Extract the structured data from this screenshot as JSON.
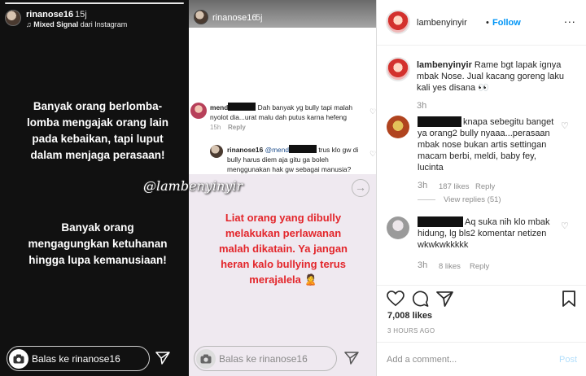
{
  "story_left": {
    "username": "rinanose16",
    "time": "15j",
    "music": "♫ Mixed Signal",
    "source": "dari Instagram",
    "paragraph1": "Banyak orang berlomba-lomba mengajak orang lain pada kebaikan, tapi luput dalam menjaga perasaan!",
    "paragraph2": "Banyak orang mengagungkan ketuhanan hingga lupa kemanusiaan!",
    "reply_placeholder": "Balas ke rinanose16"
  },
  "watermark": "@lambenyinyir",
  "story_middle": {
    "username": "rinanose16",
    "time": "5j",
    "comment1": {
      "user_prefix": "mend",
      "text": "Dah banyak yg bully tapi malah nyolot dia...urat malu dah putus karna hefeng",
      "time": "15h",
      "reply": "Reply"
    },
    "comment2": {
      "user": "rinanose16",
      "mention_prefix": "@mend",
      "text": "trus klo gw di bully harus diem aja gitu ga boleh menggunakan hak gw sebagai manusia?"
    },
    "red_text": "Liat orang yang dibully melakukan perlawanan malah dikatain. Ya jangan heran kalo bullying terus merajalela",
    "reply_placeholder": "Balas ke rinanose16"
  },
  "post": {
    "username": "lambenyinyir",
    "dot": "•",
    "follow": "Follow",
    "more": "...",
    "caption_user": "lambenyinyir",
    "caption_text": "Rame bgt lapak ignya mbak Nose. Jual kacang goreng laku kali yes disana 👀",
    "caption_time": "3h",
    "comments": [
      {
        "text": "knapa sebegitu banget ya orang2 bully nyaaa...perasaan mbak nose bukan artis settingan macam berbi, meldi, baby fey, lucinta",
        "time": "3h",
        "likes": "187 likes",
        "reply": "Reply",
        "view_replies": "View replies (51)"
      },
      {
        "text": "Aq suka nih klo mbak hidung, lg bls2 komentar netizen wkwkwkkkkk",
        "time": "3h",
        "likes": "8 likes",
        "reply": "Reply"
      }
    ],
    "likes": "7,008 likes",
    "time_ago": "3 HOURS AGO",
    "add_comment": "Add a comment...",
    "post_button": "Post"
  }
}
